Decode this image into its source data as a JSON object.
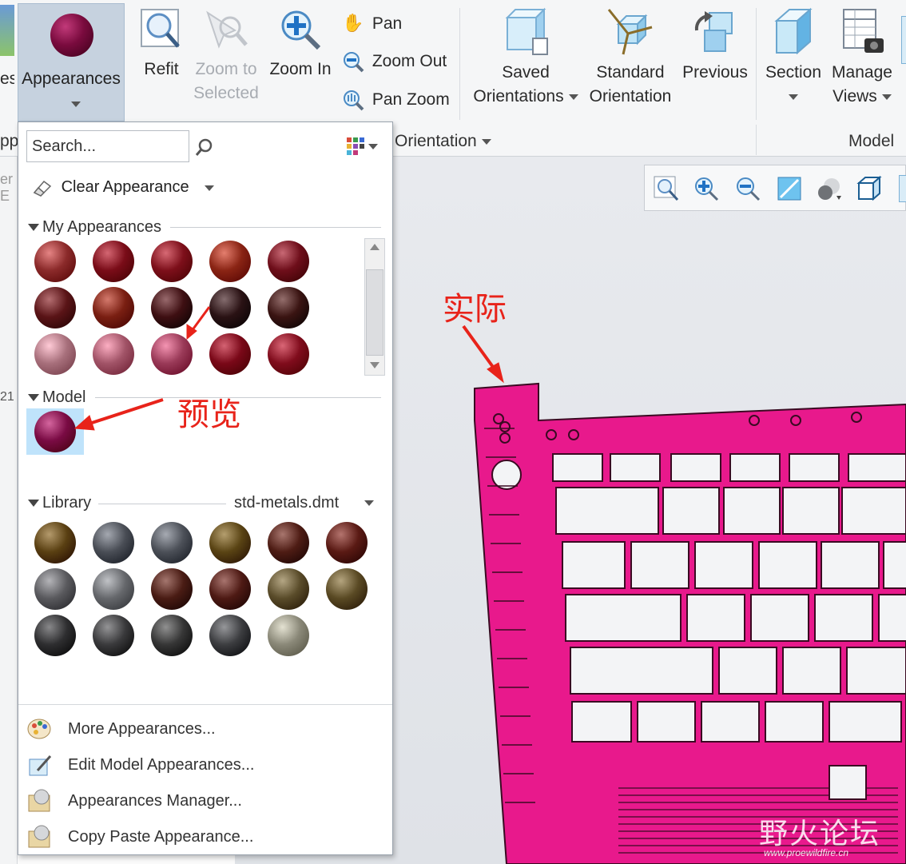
{
  "ribbon": {
    "left_partial_label": "es",
    "appearances_label": "Appearances",
    "refit_label": "Refit",
    "zoom_selected_line1": "Zoom to",
    "zoom_selected_line2": "Selected",
    "zoom_in_label": "Zoom In",
    "pan_label": "Pan",
    "zoom_out_label": "Zoom Out",
    "pan_zoom_label": "Pan Zoom",
    "saved_line1": "Saved",
    "saved_line2": "Orientations",
    "standard_line1": "Standard",
    "standard_line2": "Orientation",
    "previous_label": "Previous",
    "section_label": "Section",
    "manage_line1": "Manage",
    "manage_line2": "Views",
    "group_orientation": "Orientation",
    "group_model_display": "Model D",
    "group_left_partial": "pp"
  },
  "left_fragments": {
    "frag1": "er E",
    "frag2": "21"
  },
  "panel": {
    "search_placeholder": "Search...",
    "clear_appearance": "Clear Appearance",
    "my_appearances": "My Appearances",
    "model": "Model",
    "library": "Library",
    "library_file": "std-metals.dmt",
    "menu": {
      "more": "More Appearances...",
      "edit": "Edit Model Appearances...",
      "manager": "Appearances Manager...",
      "copy_paste": "Copy Paste Appearance..."
    }
  },
  "my_appearances_colors": [
    [
      "#8b2a2a",
      "#7a0c18",
      "#7d0f1a",
      "#8a2414",
      "#6e0e1a"
    ],
    [
      "#5a1417",
      "#7a1f12",
      "#3e0f12",
      "#2a1214",
      "#3a1412"
    ],
    [
      "#a8707c",
      "#a25468",
      "#9a3a58",
      "#7a0818",
      "#800c1c"
    ]
  ],
  "model_colors": [
    "#7a0b44"
  ],
  "library_colors": [
    [
      "#5a4012",
      "#4a4e56",
      "#4c5058",
      "#5a4414",
      "#4e1c14",
      "#5a1a14"
    ],
    [
      "#5a5a5e",
      "#66686c",
      "#4a1c14",
      "#4e1a14",
      "#5a4c2a",
      "#5a4a24"
    ],
    [
      "#2e2e30",
      "#3a3a3c",
      "#363636",
      "#3c3d40",
      "#8a8878"
    ]
  ],
  "annotations": {
    "actual": "实际",
    "preview": "预览"
  },
  "watermark": {
    "text": "野火论坛",
    "url": "www.proewildfire.cn"
  },
  "model_color": "#e8198c"
}
